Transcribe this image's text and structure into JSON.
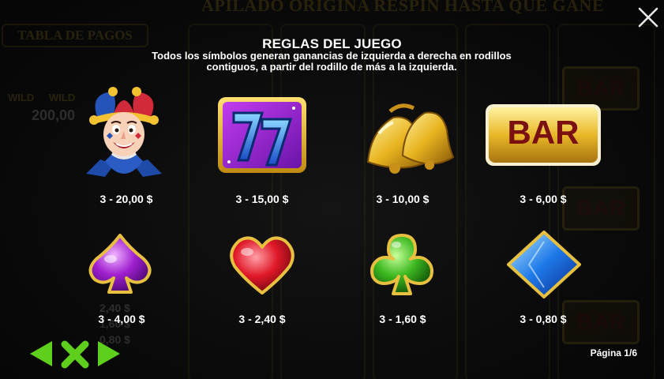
{
  "background": {
    "banner": "APILADO ORIGINA RESPIN HASTA QUE GANE",
    "paytable_tab": "TABLA DE PAGOS",
    "wild_label": "WILD",
    "jackpot": "200,00",
    "bar_label": "BAR",
    "small_values": [
      "2,40 $",
      "1,60 $",
      "0,80 $"
    ]
  },
  "rules": {
    "title": "REGLAS DEL JUEGO",
    "line1": "Todos los símbolos generan ganancias de izquierda a derecha en rodillos",
    "line2": "contiguos, a partir del rodillo de más a la izquierda."
  },
  "symbols": [
    {
      "name": "joker",
      "icon": "joker-icon",
      "payout": "3 - 20,00 $"
    },
    {
      "name": "seven",
      "icon": "double-seven-icon",
      "payout": "3 - 15,00 $"
    },
    {
      "name": "bells",
      "icon": "bells-icon",
      "payout": "3 - 10,00 $"
    },
    {
      "name": "bar",
      "icon": "bar-icon",
      "label": "BAR",
      "payout": "3 - 6,00 $"
    },
    {
      "name": "spade",
      "icon": "spade-icon",
      "payout": "3 - 4,00 $"
    },
    {
      "name": "heart",
      "icon": "heart-icon",
      "payout": "3 - 2,40 $"
    },
    {
      "name": "club",
      "icon": "club-icon",
      "payout": "3 - 1,60 $"
    },
    {
      "name": "diamond",
      "icon": "diamond-icon",
      "payout": "3 - 0,80 $"
    }
  ],
  "footer": {
    "page_indicator": "Página 1/6"
  },
  "colors": {
    "accent_green": "#5fcf1e",
    "gold": "#e6b422",
    "bar_red": "#7a1010"
  }
}
